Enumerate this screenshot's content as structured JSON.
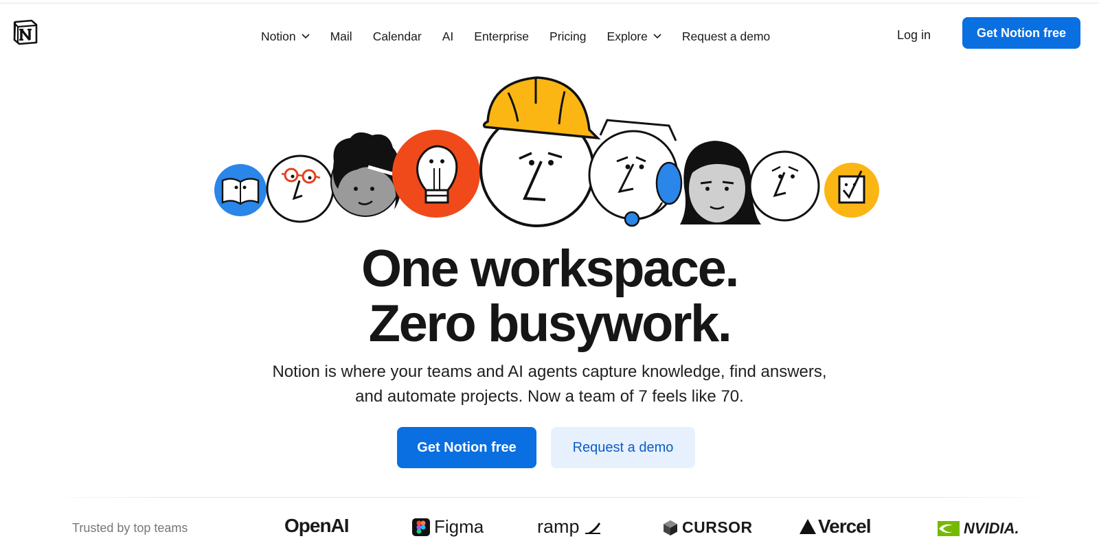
{
  "header": {
    "logo_icon": "notion-logo-icon",
    "nav": [
      {
        "label": "Notion",
        "has_dropdown": true
      },
      {
        "label": "Mail",
        "has_dropdown": false
      },
      {
        "label": "Calendar",
        "has_dropdown": false
      },
      {
        "label": "AI",
        "has_dropdown": false
      },
      {
        "label": "Enterprise",
        "has_dropdown": false
      },
      {
        "label": "Pricing",
        "has_dropdown": false
      },
      {
        "label": "Explore",
        "has_dropdown": true
      },
      {
        "label": "Request a demo",
        "has_dropdown": false
      }
    ],
    "login_label": "Log in",
    "cta_label": "Get Notion free"
  },
  "hero": {
    "illustration": [
      "book-icon",
      "glasses-face-icon",
      "curly-hair-person-icon",
      "lightbulb-icon",
      "hard-hat-face-icon",
      "headset-face-icon",
      "long-hair-woman-icon",
      "thinking-face-icon",
      "checkbox-icon"
    ],
    "headline_line1": "One workspace.",
    "headline_line2": "Zero busywork.",
    "subtext": "Notion is where your teams and AI agents capture knowledge, find answers, and automate projects. Now a team of 7 feels like 70.",
    "primary_cta": "Get Notion free",
    "secondary_cta": "Request a demo"
  },
  "trusted": {
    "label": "Trusted by top teams",
    "brands": [
      "OpenAI",
      "Figma",
      "ramp",
      "CURSOR",
      "Vercel",
      "NVIDIA."
    ]
  },
  "colors": {
    "accent": "#0a6fe0",
    "accent_light": "#e6f1fd",
    "blue_circle": "#2a86e8",
    "orange_circle": "#f04a1a",
    "yellow": "#fbb614"
  }
}
